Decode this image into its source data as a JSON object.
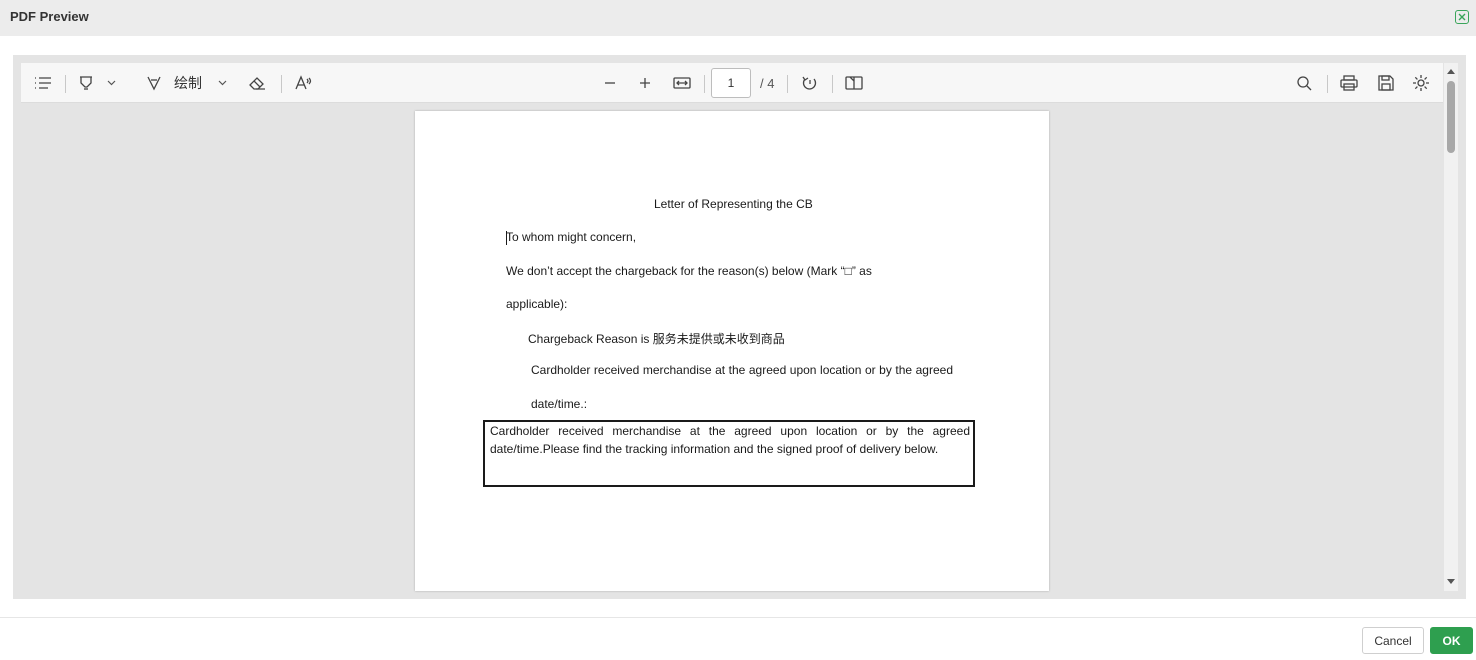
{
  "dialog": {
    "title": "PDF Preview"
  },
  "toolbar": {
    "draw_label": "绘制",
    "page_current": "1",
    "page_total": "/ 4",
    "icons": [
      "outline-icon",
      "highlight-icon",
      "draw-icon",
      "eraser-icon",
      "read-aloud-icon",
      "zoom-out-icon",
      "zoom-in-icon",
      "fit-width-icon",
      "rotate-icon",
      "two-page-icon",
      "search-icon",
      "print-icon",
      "save-icon",
      "settings-icon"
    ]
  },
  "document": {
    "title": "Letter of Representing the CB",
    "salutation": "To whom might concern,",
    "statement_line1": "We don’t accept the chargeback for the reason(s) below (Mark “□” as",
    "statement_line2": "applicable):",
    "reason": "Chargeback Reason is 服务未提供或未收到商品",
    "option_line1": "Cardholder received merchandise at the agreed upon location or by the agreed",
    "option_line2": "date/time.:",
    "box_line1": "Cardholder received merchandise at the agreed upon location or by the agreed",
    "box_line2": "date/time.Please find the tracking information and the signed proof of delivery below."
  },
  "footer": {
    "cancel_label": "Cancel",
    "ok_label": "OK"
  },
  "colors": {
    "accent": "#2e9f4f",
    "header_bg": "#ececec",
    "canvas_bg": "#e4e4e4"
  }
}
